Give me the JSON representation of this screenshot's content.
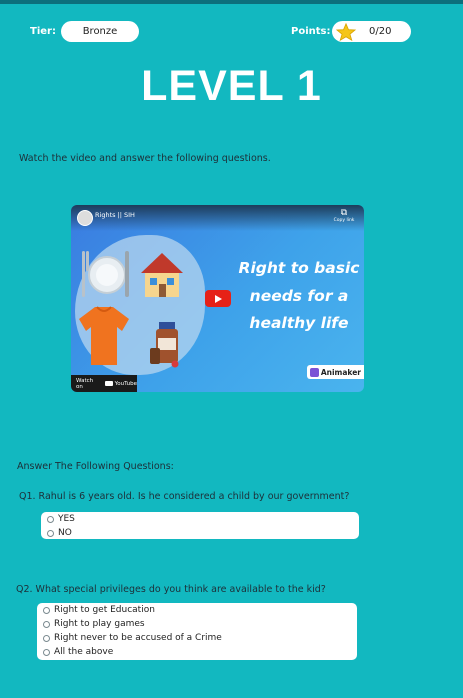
{
  "header": {
    "tier_label": "Tier:",
    "tier_value": "Bronze",
    "points_label": "Points:",
    "points_value": "0/20",
    "points_icon": "star-icon"
  },
  "page_title": "LEVEL 1",
  "instruction": "Watch the video and answer the following questions.",
  "video": {
    "channel": "Rights || SIH",
    "copy_label": "Copy link",
    "overlay_lines": [
      "Right to basic",
      "needs for a",
      "healthy life"
    ],
    "watch_on": "Watch on",
    "youtube": "YouTube",
    "brand": "Animaker"
  },
  "questions_heading": "Answer The Following Questions:",
  "questions": [
    {
      "text": "Q1. Rahul is 6 years old. Is he considered a child by our government?",
      "options": [
        "YES",
        "NO"
      ]
    },
    {
      "text": "Q2. What special privileges do you think are available to the kid?",
      "options": [
        "Right to get Education",
        "Right to play games",
        "Right never to be accused of a Crime",
        "All the above"
      ]
    }
  ],
  "colors": {
    "background": "#12b8c0",
    "accent_star": "#f5c518",
    "play_red": "#e62117"
  }
}
